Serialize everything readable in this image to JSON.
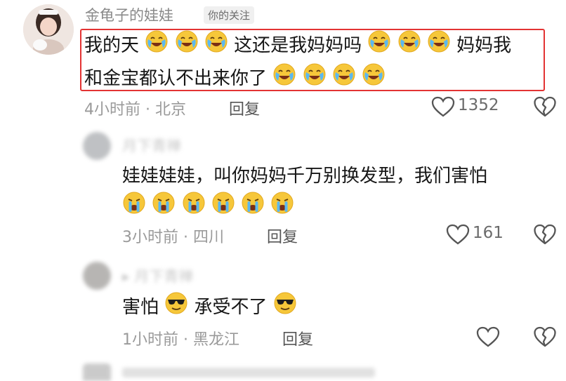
{
  "comments": [
    {
      "username": "金龟子的娃娃",
      "tag": "你的关注",
      "line1a": "我的天",
      "line1b": "这还是我妈妈吗",
      "line1c": "妈妈我",
      "line2": "和金宝都认不出来你了",
      "emoji": "sob-laugh",
      "time_location": "4小时前 · 北京",
      "reply_label": "回复",
      "likes": "1352"
    },
    {
      "username": "月下青禅",
      "text": "娃娃娃娃，叫你妈妈千万别换发型，我们害怕",
      "emoji": "crying",
      "time_location": "3小时前 · 四川",
      "reply_label": "回复",
      "likes": "161"
    },
    {
      "username": "▸ 月下青禅",
      "text_a": "害怕",
      "text_b": "承受不了",
      "emoji": "sunglasses",
      "time_location": "1小时前 · 黑龙江",
      "reply_label": "回复"
    }
  ],
  "colors": {
    "highlight_border": "#e33333",
    "meta_text": "#9a9a9a"
  }
}
